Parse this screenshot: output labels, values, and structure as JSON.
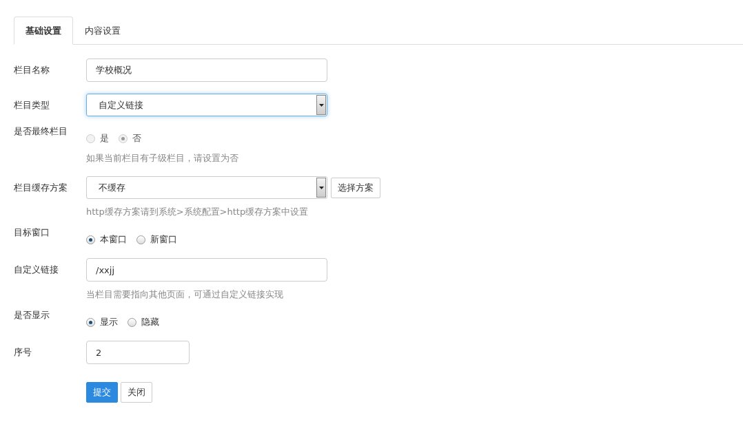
{
  "tabs": [
    {
      "label": "基础设置",
      "selected": true
    },
    {
      "label": "内容设置",
      "selected": false
    }
  ],
  "fields": [
    {
      "kind": "input",
      "label": "栏目名称",
      "value": "学校概况",
      "short": false
    },
    {
      "kind": "select",
      "label": "栏目类型",
      "value": "自定义链接",
      "focused": true
    },
    {
      "kind": "radio",
      "label": "是否最终栏目",
      "disabled": true,
      "options": [
        {
          "label": "是",
          "selected": false
        },
        {
          "label": "否",
          "selected": true
        }
      ],
      "help": "如果当前栏目有子级栏目，请设置为否"
    },
    {
      "kind": "select",
      "label": "栏目缓存方案",
      "value": "不缓存",
      "focused": false,
      "button": "选择方案",
      "help": "http缓存方案请到系统>系统配置>http缓存方案中设置"
    },
    {
      "kind": "radio",
      "label": "目标窗口",
      "disabled": false,
      "options": [
        {
          "label": "本窗口",
          "selected": true
        },
        {
          "label": "新窗口",
          "selected": false
        }
      ]
    },
    {
      "kind": "input",
      "label": "自定义链接",
      "value": "/xxjj",
      "short": false,
      "help": "当栏目需要指向其他页面，可通过自定义链接实现"
    },
    {
      "kind": "radio",
      "label": "是否显示",
      "disabled": false,
      "options": [
        {
          "label": "显示",
          "selected": true
        },
        {
          "label": "隐藏",
          "selected": false
        }
      ]
    },
    {
      "kind": "input",
      "label": "序号",
      "value": "2",
      "short": true
    }
  ],
  "buttons": [
    {
      "label": "提交",
      "kind": "primary"
    },
    {
      "label": "关闭",
      "kind": "default"
    }
  ]
}
